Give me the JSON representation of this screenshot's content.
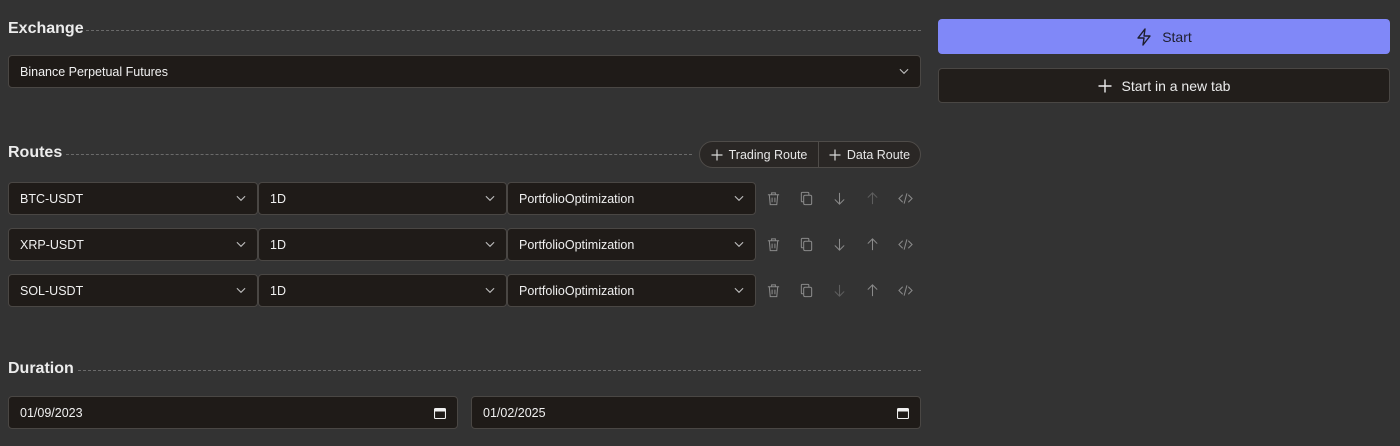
{
  "exchange": {
    "title": "Exchange",
    "selected": "Binance Perpetual Futures"
  },
  "actions": {
    "start_label": "Start",
    "start_new_tab_label": "Start in a new tab",
    "start_color": "#8088f8"
  },
  "routes": {
    "title": "Routes",
    "add_trading_label": "Trading Route",
    "add_data_label": "Data Route",
    "rows": [
      {
        "symbol": "BTC-USDT",
        "timeframe": "1D",
        "strategy": "PortfolioOptimization"
      },
      {
        "symbol": "XRP-USDT",
        "timeframe": "1D",
        "strategy": "PortfolioOptimization"
      },
      {
        "symbol": "SOL-USDT",
        "timeframe": "1D",
        "strategy": "PortfolioOptimization"
      }
    ]
  },
  "duration": {
    "title": "Duration",
    "start_date": "01/09/2023",
    "end_date": "01/02/2025"
  }
}
